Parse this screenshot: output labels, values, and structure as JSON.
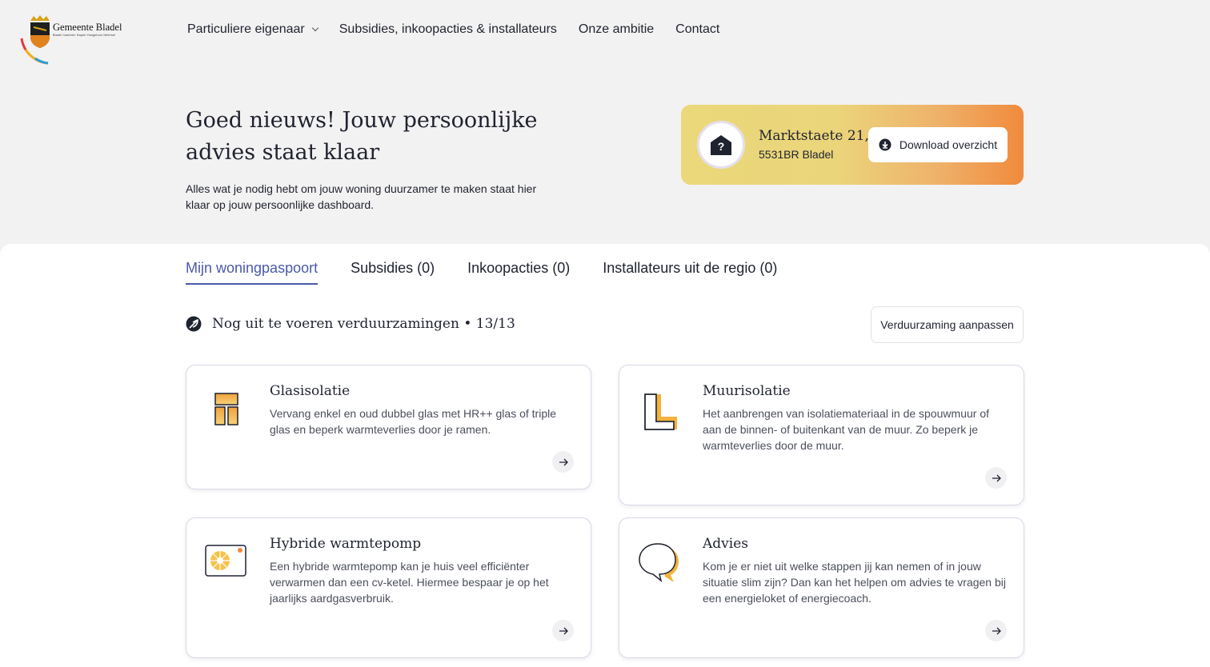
{
  "header": {
    "logo_text": "Gemeente Bladel",
    "logo_subtext": "Bladel  Casteren  Hapert  Hoogeloon  Netersel",
    "nav": [
      {
        "label": "Particuliere eigenaar",
        "has_dropdown": true
      },
      {
        "label": "Subsidies, inkoopacties & installateurs"
      },
      {
        "label": "Onze ambitie"
      },
      {
        "label": "Contact"
      }
    ]
  },
  "hero": {
    "title": "Goed nieuws! Jouw persoonlijke advies staat klaar",
    "subtitle": "Alles wat je nodig hebt om jouw woning duurzamer te maken staat hier klaar op jouw persoonlijke dashboard."
  },
  "address_card": {
    "street": "Marktstaete 21,",
    "postcode": "5531BR",
    "city": "Bladel",
    "download_label": "Download overzicht",
    "house_icon_symbol": "?"
  },
  "tabs": [
    {
      "label": "Mijn woningpaspoort",
      "active": true
    },
    {
      "label": "Subsidies (0)"
    },
    {
      "label": "Inkoopacties (0)"
    },
    {
      "label": "Installateurs uit de regio (0)"
    }
  ],
  "section": {
    "title": "Nog uit te voeren verduurzamingen • 13/13",
    "adjust_label": "Verduurzaming aanpassen"
  },
  "cards": [
    {
      "title": "Glasisolatie",
      "text": "Vervang enkel en oud dubbel glas met HR++ glas of triple glas en beperk warmteverlies door je ramen.",
      "icon": "window-icon"
    },
    {
      "title": "Muurisolatie",
      "text": "Het aanbrengen van isolatiemateriaal in de spouwmuur of aan de binnen- of buitenkant van de muur. Zo beperk je warmteverlies door de muur.",
      "icon": "wall-icon"
    },
    {
      "title": "Hybride warmtepomp",
      "text": "Een hybride warmtepomp kan je huis veel efficiënter verwarmen dan een cv-ketel. Hiermee bespaar je op het jaarlijks aardgasverbruik.",
      "icon": "heatpump-icon"
    },
    {
      "title": "Advies",
      "text": "Kom je er niet uit welke stappen jij kan nemen of in jouw situatie slim zijn? Dan kan het helpen om advies te vragen bij een energieloket of energiecoach.",
      "icon": "speech-bubble-icon"
    }
  ],
  "colors": {
    "accent": "#4a5aa8",
    "card_gradient_start": "#ead87a",
    "card_gradient_end": "#f08a3c",
    "background": "#f3f2f2"
  }
}
